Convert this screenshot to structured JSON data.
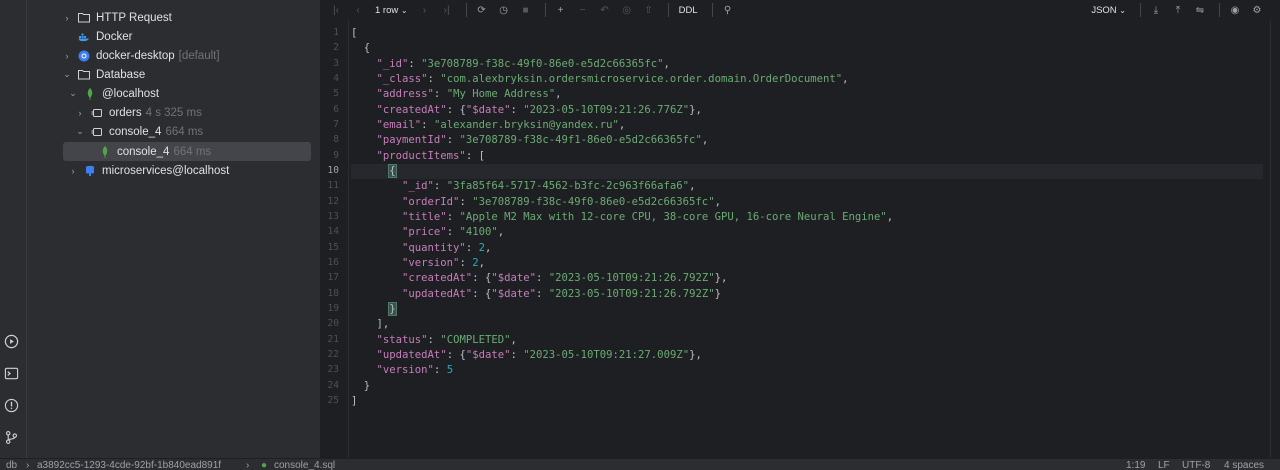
{
  "tree": {
    "items": [
      {
        "label": "HTTP Request",
        "meta": ""
      },
      {
        "label": "Docker",
        "meta": ""
      },
      {
        "label": "docker-desktop",
        "meta": "[default]"
      },
      {
        "label": "Database",
        "meta": ""
      },
      {
        "label": "@localhost",
        "meta": ""
      },
      {
        "label": "orders",
        "meta": "4 s 325 ms"
      },
      {
        "label": "console_4",
        "meta": "664 ms"
      },
      {
        "label": "console_4",
        "meta": "664 ms"
      },
      {
        "label": "microservices@localhost",
        "meta": ""
      }
    ]
  },
  "toolbar": {
    "rows_label": "1 row",
    "ddl_label": "DDL",
    "format_label": "JSON"
  },
  "editor": {
    "active_line": 10,
    "line_numbers": [
      "1",
      "2",
      "3",
      "4",
      "5",
      "6",
      "7",
      "8",
      "9",
      "10",
      "11",
      "12",
      "13",
      "14",
      "15",
      "16",
      "17",
      "18",
      "19",
      "20",
      "21",
      "22",
      "23",
      "24",
      "25"
    ],
    "document": {
      "_id": "3e708789-f38c-49f0-86e0-e5d2c66365fc",
      "_class": "com.alexbryksin.ordersmicroservice.order.domain.OrderDocument",
      "address": "My Home Address",
      "createdAt": "2023-05-10T09:21:26.776Z",
      "email": "alexander.bryksin@yandex.ru",
      "paymentId": "3e708789-f38c-49f1-86e0-e5d2c66365fc",
      "productItems": [
        {
          "_id": "3fa85f64-5717-4562-b3fc-2c963f66afa6",
          "orderId": "3e708789-f38c-49f0-86e0-e5d2c66365fc",
          "title": "Apple M2 Max with 12-core CPU, 38-core GPU, 16-core Neural Engine",
          "price": "4100",
          "quantity": 2,
          "version": 2,
          "createdAt": "2023-05-10T09:21:26.792Z",
          "updatedAt": "2023-05-10T09:21:26.792Z"
        }
      ],
      "status": "COMPLETED",
      "updatedAt": "2023-05-10T09:21:27.009Z",
      "version": 5
    }
  },
  "statusbar": {
    "root": "db",
    "crumb_id": "a3892cc5-1293-4cde-92bf-1b840ead891f",
    "file": "console_4.sql",
    "position": "1:19",
    "line_sep": "LF",
    "encoding": "UTF-8",
    "indent": "4 spaces"
  }
}
